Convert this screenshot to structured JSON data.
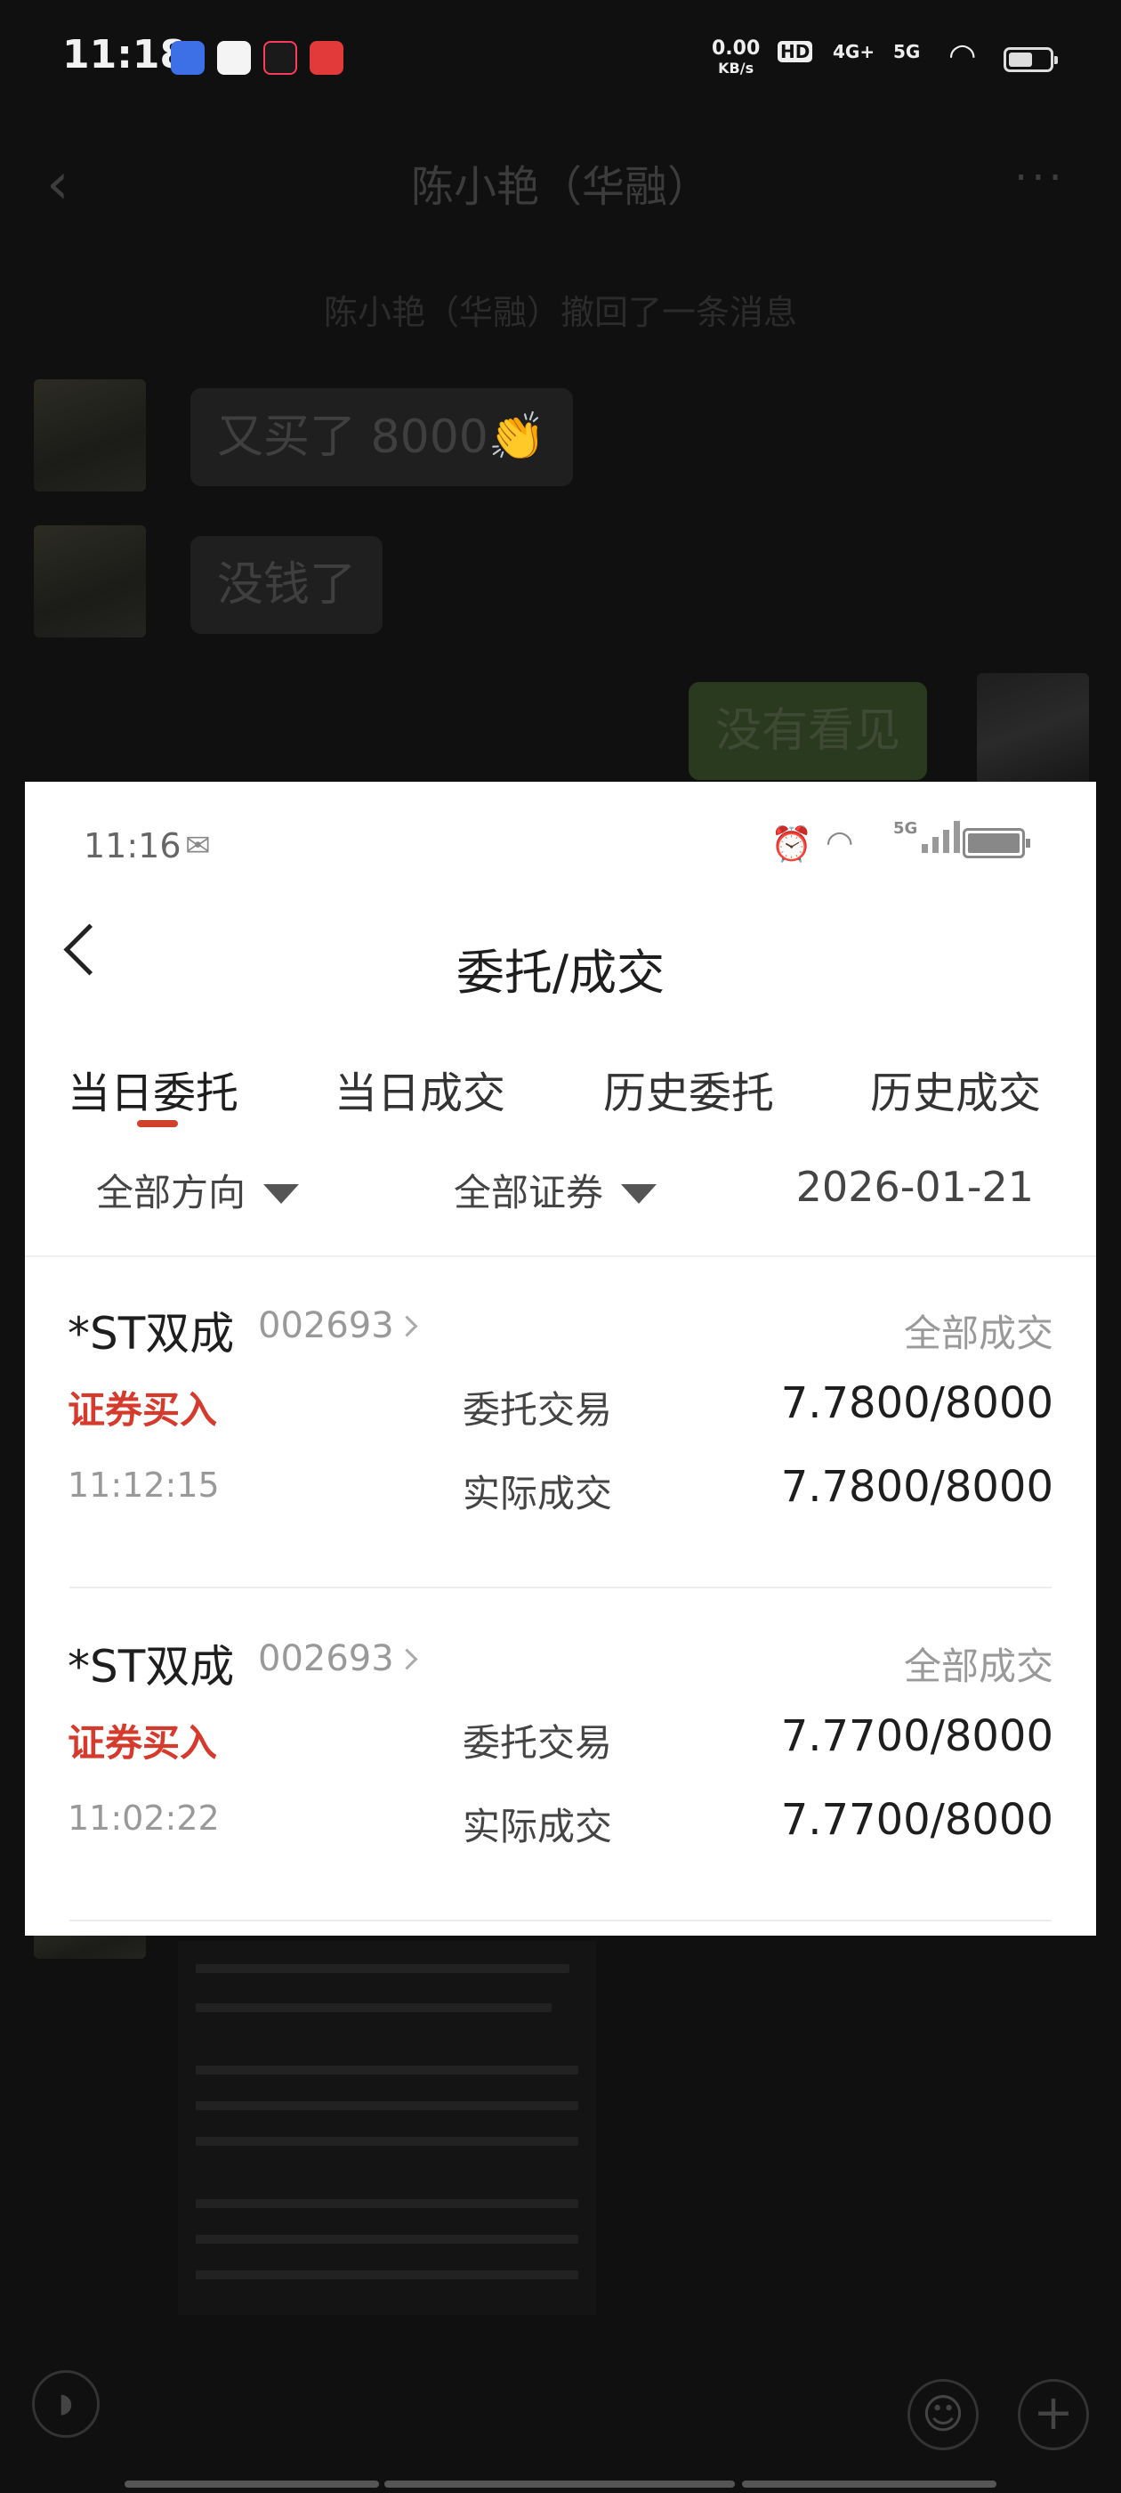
{
  "status_bar": {
    "time": "11:18",
    "net_speed": "0.00",
    "net_unit": "KB/s",
    "hd": "HD",
    "net_4g": "4G+",
    "net_5g": "5G",
    "app_icons": [
      "baidu-icon",
      "mail-icon",
      "tiktok-icon",
      "news-app-icon"
    ]
  },
  "chat": {
    "title": "陈小艳（华融）",
    "notice": "陈小艳（华融）撤回了一条消息",
    "messages": [
      {
        "from": "other",
        "text": "又买了 8000👏"
      },
      {
        "from": "other",
        "text": "没钱了"
      },
      {
        "from": "me",
        "text": "没有看见"
      }
    ]
  },
  "screenshot": {
    "status": {
      "time": "11:16",
      "signal": "5G"
    },
    "title": "委托/成交",
    "tabs": [
      {
        "label": "当日委托",
        "active": true
      },
      {
        "label": "当日成交",
        "active": false
      },
      {
        "label": "历史委托",
        "active": false
      },
      {
        "label": "历史成交",
        "active": false
      }
    ],
    "filters": {
      "direction": "全部方向",
      "security": "全部证券",
      "date": "2026-01-21"
    },
    "records": [
      {
        "name": "*ST双成",
        "code": "002693",
        "status": "全部成交",
        "direction": "证券买入",
        "time": "11:12:15",
        "order_label": "委托交易",
        "order_value": "7.7800/8000",
        "deal_label": "实际成交",
        "deal_value": "7.7800/8000"
      },
      {
        "name": "*ST双成",
        "code": "002693",
        "status": "全部成交",
        "direction": "证券买入",
        "time": "11:02:22",
        "order_label": "委托交易",
        "order_value": "7.7700/8000",
        "deal_label": "实际成交",
        "deal_value": "7.7700/8000"
      }
    ]
  },
  "colors": {
    "accent_red": "#d53a2c",
    "tab_underline": "#d0402a",
    "background": "#101010"
  }
}
